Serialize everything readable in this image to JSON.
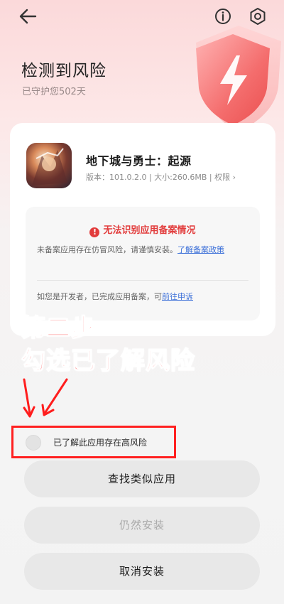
{
  "header": {
    "title": "检测到风险",
    "subtitle": "已守护您502天"
  },
  "icons": {
    "back": "back-arrow-icon",
    "info": "info-icon",
    "settings": "gear-icon",
    "shield": "shield-lightning-icon"
  },
  "app": {
    "name": "地下城与勇士：起源",
    "meta": "版本：101.0.2.0 | 大小:260.6MB | 权限 ›"
  },
  "warning": {
    "title": "无法识别应用备案情况",
    "text": "未备案应用存在仿冒风险，请谨慎安装。",
    "link": "了解备案政策",
    "dev_text": "如您是开发者，已完成应用备案，可",
    "dev_link": "前往申诉"
  },
  "annotation": {
    "line1": "第二步",
    "line2": "勾选已了解风险"
  },
  "checkbox": {
    "label": "已了解此应用存在高风险",
    "checked": false
  },
  "buttons": {
    "similar": "查找类似应用",
    "install": "仍然安装",
    "cancel": "取消安装"
  },
  "colors": {
    "accent_red": "#e23c3c",
    "link_blue": "#3b6fd8",
    "annotation_red": "#ff1d1d",
    "button_bg": "#e8e8e8"
  }
}
